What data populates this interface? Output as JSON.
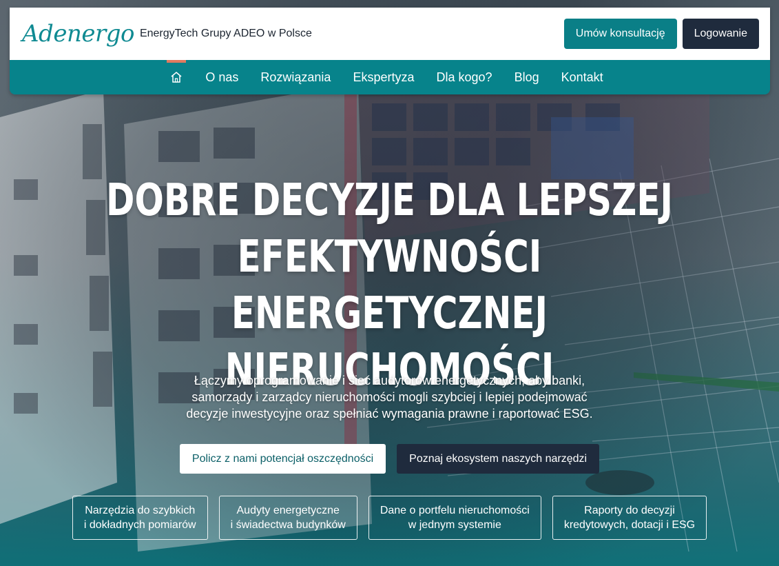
{
  "header": {
    "logo_script": "Adenergo",
    "logo_tagline": "EnergyTech Grupy ADEO w Polsce",
    "consult_button": "Umów konsultację",
    "login_button": "Logowanie"
  },
  "nav": {
    "home_icon": "home-icon",
    "items": [
      {
        "label": "O nas"
      },
      {
        "label": "Rozwiązania"
      },
      {
        "label": "Ekspertyza"
      },
      {
        "label": "Dla kogo?"
      },
      {
        "label": "Blog"
      },
      {
        "label": "Kontakt"
      }
    ],
    "active_accent": "#e07a5f"
  },
  "hero": {
    "title_lines": [
      "DOBRE DECYZJE DLA LEPSZEJ",
      "EFEKTYWNOŚCI ENERGETYCZNEJ",
      "NIERUCHOMOŚCI"
    ],
    "subtitle": "Łączymy oprogramowanie i sieć audytorów energetycznych, aby banki, samorządy i zarządcy nieruchomości mogli szybciej i lepiej podejmować decyzje inwestycyjne oraz spełniać wymagania prawne i raportować ESG.",
    "cta_primary": "Policz z nami potencjał oszczędności",
    "cta_secondary": "Poznaj ekosystem naszych narzędzi"
  },
  "features": [
    {
      "line1": "Narzędzia do szybkich",
      "line2": "i dokładnych pomiarów"
    },
    {
      "line1": "Audyty energetyczne",
      "line2": "i świadectwa budynków"
    },
    {
      "line1": "Dane o portfelu nieruchomości",
      "line2": "w jednym systemie"
    },
    {
      "line1": "Raporty do decyzji",
      "line2": "kredytowych, dotacji i ESG"
    }
  ],
  "colors": {
    "brand_teal": "#07838b",
    "dark_navy": "#1f2b3d",
    "accent_coral": "#e07a5f"
  }
}
